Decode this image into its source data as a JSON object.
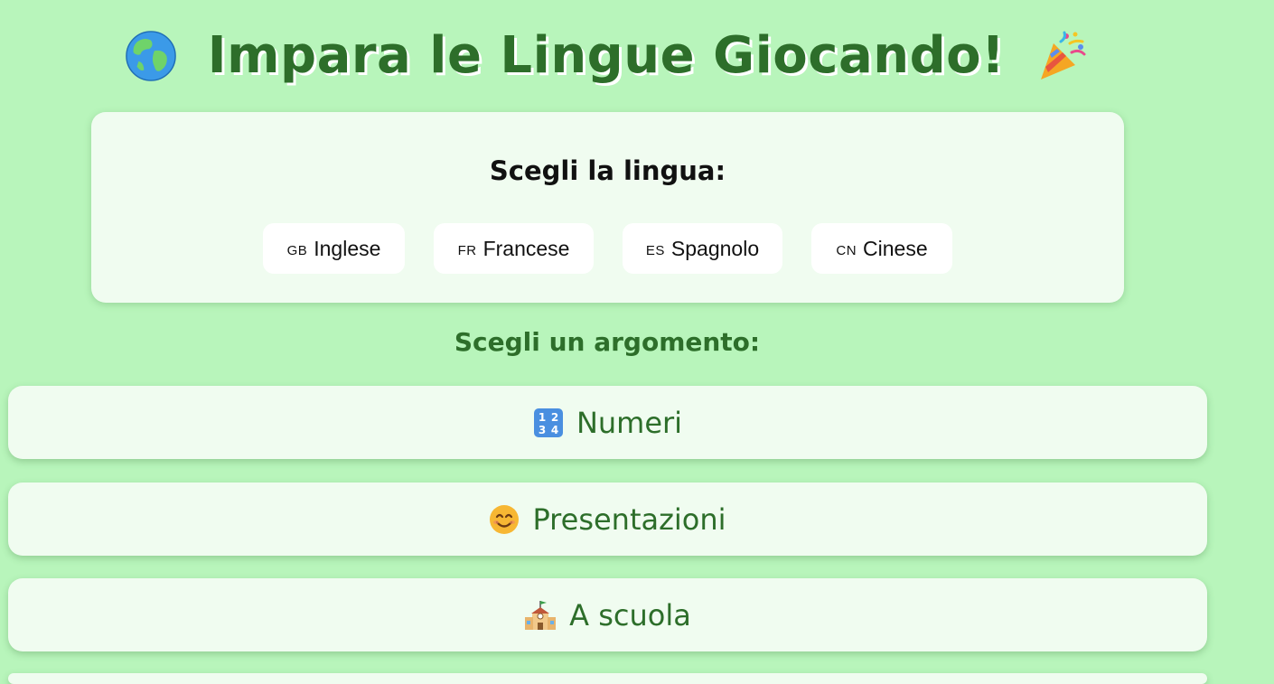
{
  "header": {
    "title": "Impara le Lingue Giocando!",
    "left_icon": "globe-icon",
    "right_icon": "party-popper-icon"
  },
  "language_panel": {
    "heading": "Scegli la lingua:",
    "languages": [
      {
        "code": "GB",
        "label": "Inglese"
      },
      {
        "code": "FR",
        "label": "Francese"
      },
      {
        "code": "ES",
        "label": "Spagnolo"
      },
      {
        "code": "CN",
        "label": "Cinese"
      }
    ]
  },
  "topics": {
    "heading": "Scegli un argomento:",
    "items": [
      {
        "icon": "numbers-icon",
        "label": "Numeri"
      },
      {
        "icon": "smiling-face-icon",
        "label": "Presentazioni"
      },
      {
        "icon": "school-icon",
        "label": "A scuola"
      }
    ]
  },
  "colors": {
    "background": "#b8f5bb",
    "accent_text": "#2d6e2a",
    "card": "#f0fcf0"
  }
}
